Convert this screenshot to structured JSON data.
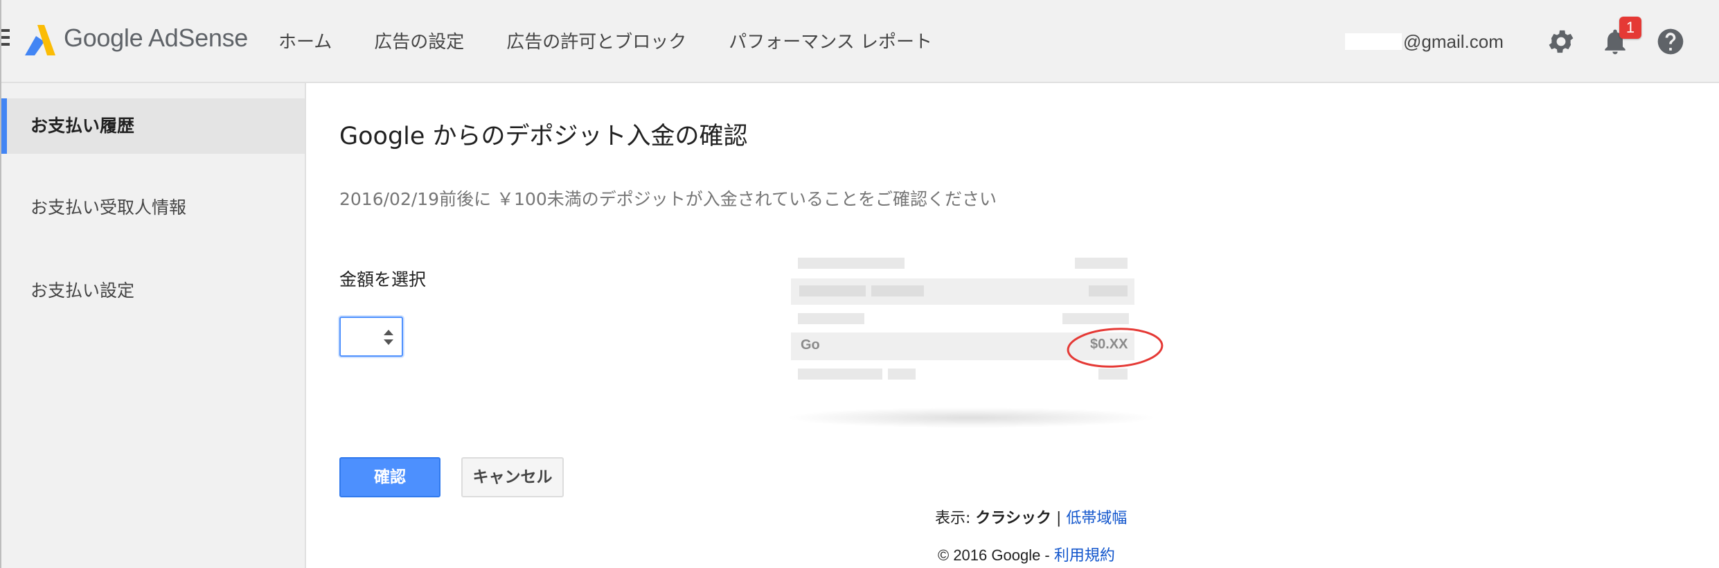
{
  "app": {
    "name": "Google AdSense"
  },
  "nav": {
    "items": [
      {
        "label": "ホーム"
      },
      {
        "label": "広告の設定"
      },
      {
        "label": "広告の許可とブロック"
      },
      {
        "label": "パフォーマンス レポート"
      }
    ]
  },
  "header": {
    "account_email": "@gmail.com",
    "notification_count": "1",
    "icons": [
      "menu-icon",
      "adsense-logo-icon",
      "gear-icon",
      "bell-icon",
      "help-icon"
    ]
  },
  "sidebar": {
    "items": [
      {
        "label": "お支払い履歴",
        "active": true
      },
      {
        "label": "お支払い受取人情報",
        "active": false
      },
      {
        "label": "お支払い設定",
        "active": false
      }
    ]
  },
  "main": {
    "title": "Google からのデポジット入金の確認",
    "instructions": "2016/02/19前後に ￥100未満のデポジットが入金されていることをご確認ください",
    "amount_label": "金額を選択",
    "amount_value": "",
    "confirm_label": "確認",
    "cancel_label": "キャンセル"
  },
  "illustration": {
    "row_label": "Go",
    "amount_hint": "$0.XX",
    "highlight_color": "#e53935"
  },
  "footer": {
    "view_prefix": "表示:",
    "view_mode": "クラシック",
    "separator": "|",
    "low_bandwidth": "低帯域幅",
    "copyright": "© 2016 Google -",
    "terms": "利用規約"
  },
  "colors": {
    "accent": "#4285f4",
    "button_primary": "#4d90fe",
    "badge": "#e53935",
    "link": "#1155cc"
  }
}
